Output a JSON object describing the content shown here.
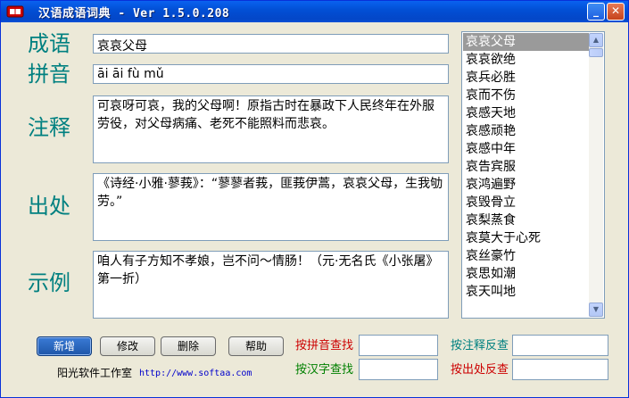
{
  "window": {
    "title": "汉语成语词典 - Ver 1.5.0.208"
  },
  "labels": {
    "idiom": "成语",
    "pinyin": "拼音",
    "explanation": "注释",
    "source": "出处",
    "example": "示例"
  },
  "fields": {
    "idiom": "哀哀父母",
    "pinyin": "āi   āi   fù   mǔ",
    "explanation": "可哀呀可哀，我的父母啊！原指古时在暴政下人民终年在外服劳役，对父母病痛、老死不能照料而悲哀。",
    "source": "《诗经·小雅·蓼莪》：“蓼蓼者莪，匪莪伊蒿，哀哀父母，生我劬劳。”",
    "example": "咱人有子方知不孝娘，岂不问～情肠！（元·无名氏《小张屠》第一折）"
  },
  "idiom_list": {
    "selected_index": 0,
    "items": [
      "哀哀父母",
      "哀兵必胜",
      "哀而不伤",
      "哀感天地",
      "哀感顽艳",
      "哀感中年",
      "哀告宾服",
      "哀鸿遍野",
      "哀毁骨立",
      "哀梨蒸食",
      "哀莫大于心死",
      "哀丝豪竹",
      "哀思如潮",
      "哀天叫地",
      "哀哀欲绝"
    ],
    "display_order": [
      0,
      14,
      1,
      2,
      3,
      4,
      5,
      6,
      7,
      8,
      9,
      10,
      11,
      12,
      13
    ]
  },
  "buttons": {
    "new": "新增",
    "edit": "修改",
    "delete": "删除",
    "help": "帮助"
  },
  "search": {
    "by_pinyin": "按拼音查找",
    "by_char": "按汉字查找",
    "reverse_by_explanation": "按注释反查",
    "reverse_by_source": "按出处反查"
  },
  "footer": {
    "company": "阳光软件工作室",
    "url": "http://www.softaa.com"
  },
  "colors": {
    "label_teal": "#008080",
    "search_red": "#cc0000",
    "search_green": "#008000",
    "search_teal": "#008080",
    "url_blue": "#0000cc",
    "selection_gray": "#9a9a9a"
  },
  "icons": [
    "book-icon",
    "minimize-icon",
    "close-icon",
    "scroll-up-icon",
    "scroll-down-icon"
  ]
}
